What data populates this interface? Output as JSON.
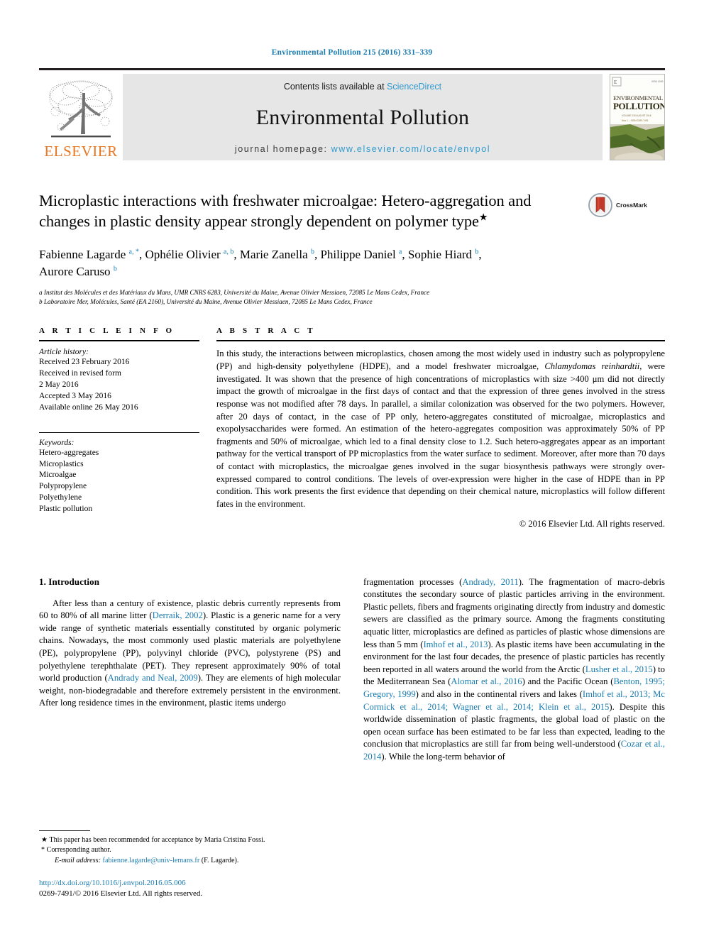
{
  "running_head": "Environmental Pollution 215 (2016) 331–339",
  "masthead": {
    "contents_prefix": "Contents lists available at ",
    "sciencedirect": "ScienceDirect",
    "journal_name": "Environmental Pollution",
    "homepage_prefix": "journal homepage: ",
    "homepage_url": "www.elsevier.com/locate/envpol",
    "publisher_logo_text": "ELSEVIER",
    "cover_title_line1": "ENVIRONMENTAL",
    "cover_title_line2": "POLLUTION",
    "accent_blue": "#2e9ad0",
    "elsevier_orange": "#e87722"
  },
  "article": {
    "title": "Microplastic interactions with freshwater microalgae: Hetero-aggregation and changes in plastic density appear strongly dependent on polymer type",
    "title_footnote_marker": "★",
    "crossmark_label": "CrossMark",
    "authors": "Fabienne Lagarde a, *, Ophélie Olivier a, b, Marie Zanella b, Philippe Daniel a, Sophie Hiard b, Aurore Caruso b",
    "affiliation_a": "a Institut des Molécules et des Matériaux du Mans, UMR CNRS 6283, Université du Maine, Avenue Olivier Messiaen, 72085 Le Mans Cedex, France",
    "affiliation_b": "b Laboratoire Mer, Molécules, Santé (EA 2160), Université du Maine, Avenue Olivier Messiaen, 72085 Le Mans Cedex, France"
  },
  "article_info": {
    "heading": "A R T I C L E   I N F O",
    "history_label": "Article history:",
    "history": [
      "Received 23 February 2016",
      "Received in revised form",
      "2 May 2016",
      "Accepted 3 May 2016",
      "Available online 26 May 2016"
    ],
    "keywords_label": "Keywords:",
    "keywords": [
      "Hetero-aggregates",
      "Microplastics",
      "Microalgae",
      "Polypropylene",
      "Polyethylene",
      "Plastic pollution"
    ]
  },
  "abstract": {
    "heading": "A B S T R A C T",
    "part1": "In this study, the interactions between microplastics, chosen among the most widely used in industry such as polypropylene (PP) and high-density polyethylene (HDPE), and a model freshwater microalgae, ",
    "species": "Chlamydomas reinhardtii",
    "part2": ", were investigated. It was shown that the presence of high concentrations of microplastics with size >400 μm did not directly impact the growth of microalgae in the first days of contact and that the expression of three genes involved in the stress response was not modified after 78 days. In parallel, a similar colonization was observed for the two polymers. However, after 20 days of contact, in the case of PP only, hetero-aggregates constituted of microalgae, microplastics and exopolysaccharides were formed. An estimation of the hetero-aggregates composition was approximately 50% of PP fragments and 50% of microalgae, which led to a final density close to 1.2. Such hetero-aggregates appear as an important pathway for the vertical transport of PP microplastics from the water surface to sediment. Moreover, after more than 70 days of contact with microplastics, the microalgae genes involved in the sugar biosynthesis pathways were strongly over-expressed compared to control conditions. The levels of over-expression were higher in the case of HDPE than in PP condition. This work presents the first evidence that depending on their chemical nature, microplastics will follow different fates in the environment.",
    "copyright": "© 2016 Elsevier Ltd. All rights reserved."
  },
  "introduction": {
    "heading": "1.  Introduction",
    "left_paragraph_prefix": "After less than a century of existence, plastic debris currently represents from 60 to 80% of all marine litter (",
    "ref_derraik": "Derraik, 2002",
    "left_paragraph_mid": "). Plastic is a generic name for a very wide range of synthetic materials essentially constituted by organic polymeric chains. Nowadays, the most commonly used plastic materials are polyethylene (PE), polypropylene (PP), polyvinyl chloride (PVC), polystyrene (PS) and polyethylene terephthalate (PET). They represent approximately 90% of total world production (",
    "ref_andrady_neal": "Andrady and Neal, 2009",
    "left_paragraph_end": "). They are elements of high molecular weight, non-biodegradable and therefore extremely persistent in the environment. After long residence times in the environment, plastic items undergo",
    "right_prefix": "fragmentation processes (",
    "ref_andrady": "Andrady, 2011",
    "right_seg1": "). The fragmentation of macro-debris constitutes the secondary source of plastic particles arriving in the environment. Plastic pellets, fibers and fragments originating directly from industry and domestic sewers are classified as the primary source. Among the fragments constituting aquatic litter, microplastics are defined as particles of plastic whose dimensions are less than 5 mm (",
    "ref_imhof": "Imhof et al., 2013",
    "right_seg2": "). As plastic items have been accumulating in the environment for the last four decades, the presence of plastic particles has recently been reported in all waters around the world from the Arctic (",
    "ref_lusher": "Lusher et al., 2015",
    "right_seg3": ") to the Mediterranean Sea (",
    "ref_alomar": "Alomar et al., 2016",
    "right_seg4": ") and the Pacific Ocean (",
    "ref_benton_gregory": "Benton, 1995; Gregory, 1999",
    "right_seg5": ") and also in the continental rivers and lakes (",
    "ref_lakes": "Imhof et al., 2013; Mc Cormick et al., 2014; Wagner et al., 2014; Klein et al., 2015",
    "right_seg6": "). Despite this worldwide dissemination of plastic fragments, the global load of plastic on the open ocean surface has been estimated to be far less than expected, leading to the conclusion that microplastics are still far from being well-understood (",
    "ref_cozar": "Cozar et al., 2014",
    "right_seg7": "). While the long-term behavior of"
  },
  "footnotes": {
    "star_marker": "★",
    "star_text": "This paper has been recommended for acceptance by Maria Cristina Fossi.",
    "corresponding_marker": "*",
    "corresponding_text": "Corresponding author.",
    "email_label": "E-mail address:",
    "email": "fabienne.lagarde@univ-lemans.fr",
    "email_suffix": "(F. Lagarde).",
    "doi": "http://dx.doi.org/10.1016/j.envpol.2016.05.006",
    "issn_line": "0269-7491/© 2016 Elsevier Ltd. All rights reserved."
  }
}
